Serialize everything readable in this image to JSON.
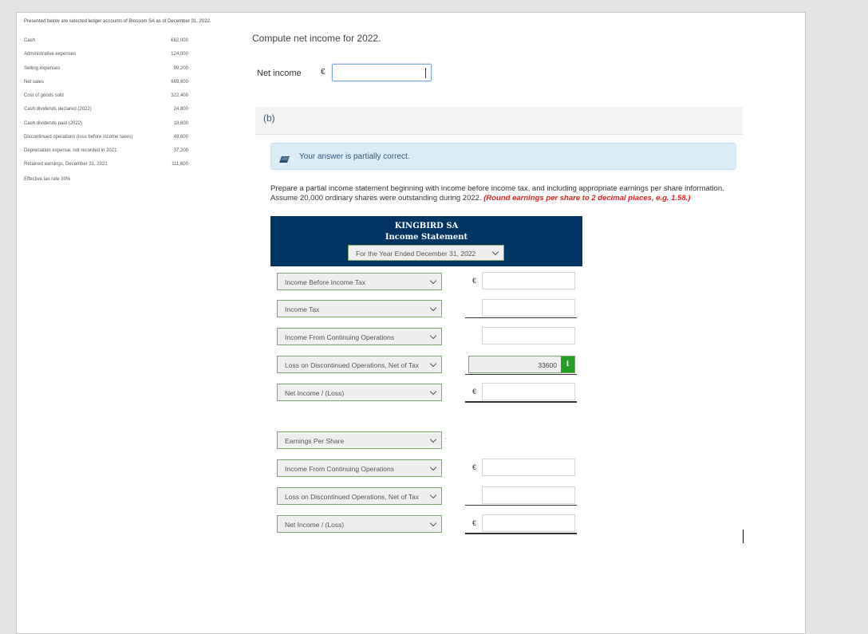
{
  "ledger": {
    "intro": "Presented below are selected ledger accounts of Blossom SA as of December 31, 2022.",
    "rows": [
      {
        "label": "Cash",
        "value": "€62,000"
      },
      {
        "label": "Administrative expenses",
        "value": "124,000"
      },
      {
        "label": "Selling expenses",
        "value": "99,200"
      },
      {
        "label": "Net sales",
        "value": "669,600"
      },
      {
        "label": "Cost of goods sold",
        "value": "322,400"
      },
      {
        "label": "Cash dividends declared (2022)",
        "value": "24,800"
      },
      {
        "label": "Cash dividends paid (2022)",
        "value": "18,600"
      },
      {
        "label": "Discontinued operations (loss before income taxes)",
        "value": "49,600"
      },
      {
        "label": "Depreciation expense, not recorded in 2021",
        "value": "37,200"
      },
      {
        "label": "Retained earnings, December 31, 2021",
        "value": "111,600"
      }
    ],
    "note": "Effective tax rate 30%"
  },
  "part_a": {
    "question": "Compute net income for 2022.",
    "net_income_label": "Net income",
    "currency": "€",
    "net_income_value": ""
  },
  "part_b": {
    "label": "(b)",
    "feedback": "Your answer is partially correct.",
    "instructions": "Prepare a partial income statement beginning with income before income tax, and including appropriate earnings per share information. Assume 20,000 ordinary shares were outstanding during 2022.",
    "instructions_note": "(Round earnings per share to 2 decimal places, e.g. 1.58.)",
    "statement": {
      "company": "KINGBIRD SA",
      "title": "Income Statement",
      "period": "For the Year Ended December 31, 2022",
      "rows": [
        {
          "label": "Income Before Income Tax",
          "currency": "€",
          "value": ""
        },
        {
          "label": "Income Tax",
          "currency": "",
          "value": ""
        },
        {
          "label": "Income From Continuing Operations",
          "currency": "",
          "value": ""
        },
        {
          "label": "Loss on Discontinued Operations, Net of Tax",
          "currency": "",
          "value": "33600"
        },
        {
          "label": "Net Income / (Loss)",
          "currency": "€",
          "value": ""
        },
        {
          "label": "Earnings Per Share",
          "currency": "",
          "value": ""
        },
        {
          "label": "Income From Continuing Operations",
          "currency": "€",
          "value": ""
        },
        {
          "label": "Loss on Discontinued Operations, Net of Tax",
          "currency": "",
          "value": ""
        },
        {
          "label": "Net Income / (Loss)",
          "currency": "€",
          "value": ""
        }
      ],
      "eps_colon": ":",
      "info_badge": "i"
    }
  }
}
